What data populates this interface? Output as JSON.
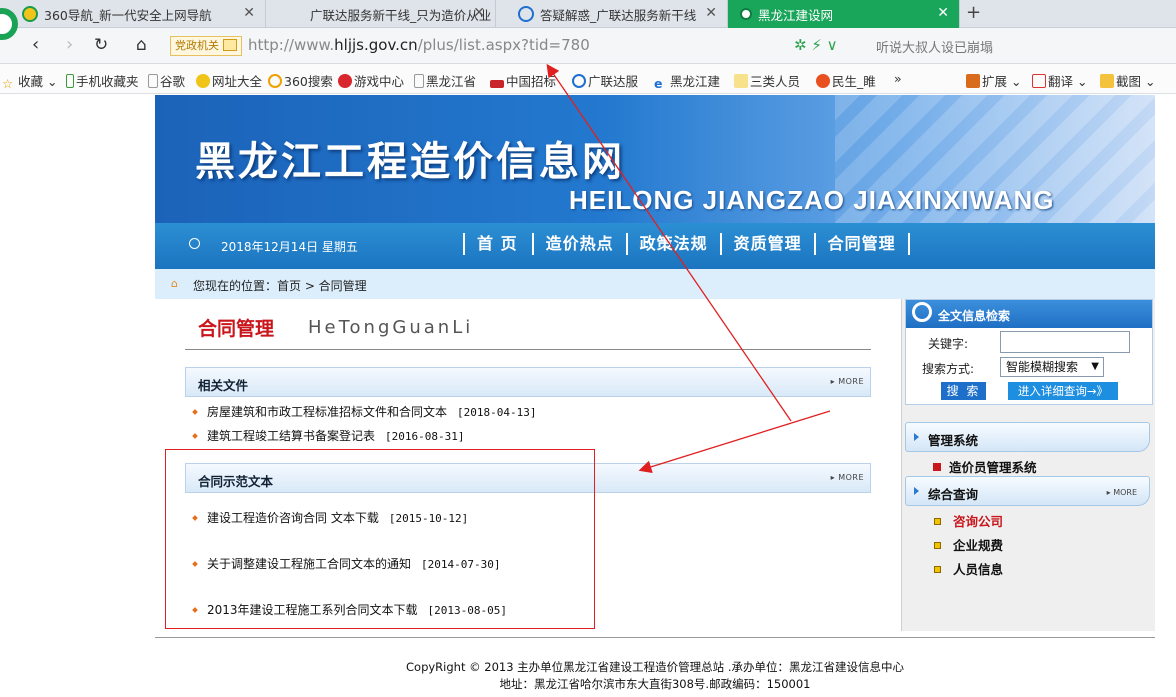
{
  "browser": {
    "tabs": [
      {
        "title": "360导航_新一代安全上网导航",
        "active": false
      },
      {
        "title": "广联达服务新干线_只为造价从业",
        "active": false
      },
      {
        "title": "答疑解惑_广联达服务新干线",
        "active": false
      },
      {
        "title": "黑龙江建设网",
        "active": true
      }
    ],
    "gov_badge": "党政机关",
    "url_prefix": "http://www.",
    "url_domain": "hljjs.gov.cn",
    "url_rest": "/plus/list.aspx?tid=780",
    "search_hint": "听说大叔人设已崩塌",
    "bookmarks": [
      "收藏",
      "手机收藏夹",
      "谷歌",
      "网址大全",
      "360搜索",
      "游戏中心",
      "黑龙江省",
      "中国招标",
      "广联达服",
      "黑龙江建",
      "三类人员",
      "民生_睢"
    ],
    "bookmark_more": "»",
    "ext_items": [
      "扩展",
      "翻译",
      "截图"
    ]
  },
  "site": {
    "title": "黑龙江工程造价信息网",
    "subtitle": "HEILONG JIANGZAO JIAXINXIWANG",
    "date": "2018年12月14日 星期五",
    "menu": [
      "首 页",
      "造价热点",
      "政策法规",
      "资质管理",
      "合同管理"
    ],
    "breadcrumb": "您现在的位置：首页 > 合同管理",
    "section_title": "合同管理",
    "section_title_en": "HeTongGuanLi",
    "more_label": "MORE",
    "related": {
      "title": "相关文件",
      "items": [
        {
          "text": "房屋建筑和市政工程标准招标文件和合同文本",
          "date": "[2018-04-13]"
        },
        {
          "text": "建筑工程竣工结算书备案登记表",
          "date": "[2016-08-31]"
        }
      ]
    },
    "samples": {
      "title": "合同示范文本",
      "items": [
        {
          "text": "建设工程造价咨询合同 文本下载",
          "date": "[2015-10-12]"
        },
        {
          "text": "关于调整建设工程施工合同文本的通知",
          "date": "[2014-07-30]"
        },
        {
          "text": "2013年建设工程施工系列合同文本下载",
          "date": "[2013-08-05]"
        }
      ]
    },
    "search": {
      "title": "全文信息检索",
      "keyword_label": "关键字:",
      "mode_label": "搜索方式:",
      "mode_value": "智能模糊搜索",
      "search_btn": "搜 索",
      "advanced_btn": "进入详细查询→》"
    },
    "manage": {
      "title": "管理系统",
      "link": "造价员管理系统"
    },
    "query": {
      "title": "综合查询",
      "links": [
        "咨询公司",
        "企业规费",
        "人员信息"
      ]
    },
    "footer_line1": "CopyRight © 2013 主办单位黑龙江省建设工程造价管理总站 .承办单位：黑龙江省建设信息中心",
    "footer_line2": "地址：黑龙江省哈尔滨市东大直街308号.邮政编码：150001"
  },
  "colors": {
    "active_tab": "#19a55a",
    "menu_blue": "#1b74bf",
    "accent_red": "#c9161c",
    "annotation_red": "#e02020"
  }
}
